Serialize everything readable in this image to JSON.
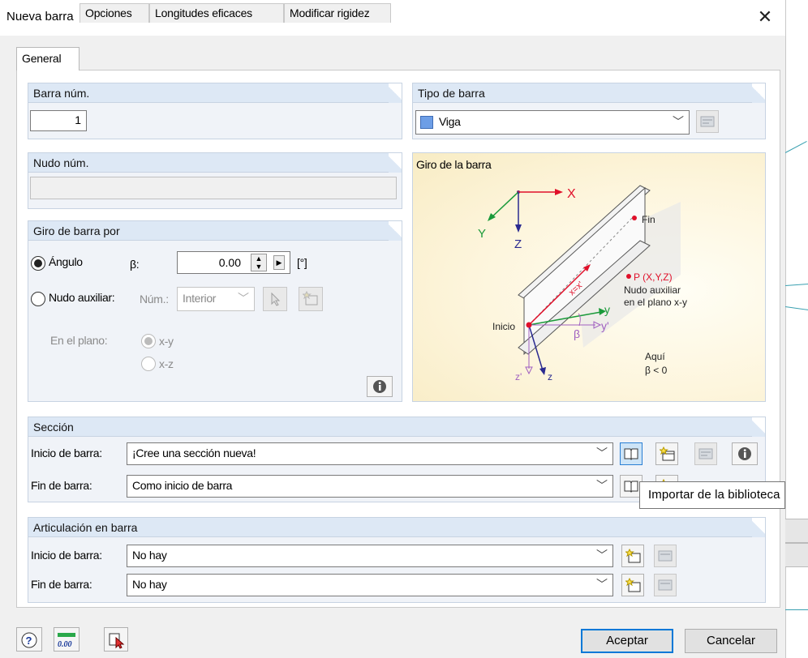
{
  "window": {
    "title": "Nueva barra",
    "close_symbol": "✕"
  },
  "tabs": [
    {
      "label": "General",
      "active": true
    },
    {
      "label": "Opciones",
      "active": false
    },
    {
      "label": "Longitudes eficaces",
      "active": false
    },
    {
      "label": "Modificar rigidez",
      "active": false
    }
  ],
  "barra_num": {
    "title": "Barra núm.",
    "value": "1"
  },
  "tipo_barra": {
    "title": "Tipo de barra",
    "value": "Viga",
    "color": "#6d9ee6"
  },
  "nudo_num": {
    "title": "Nudo núm.",
    "value": ""
  },
  "giro": {
    "title": "Giro de barra por",
    "angulo_label": "Ángulo",
    "beta_label": "β:",
    "beta_value": "0.00",
    "unit": "[°]",
    "nudo_aux_label": "Nudo auxiliar:",
    "num_label": "Núm.:",
    "num_combo": "Interior",
    "plano_label": "En el plano:",
    "plano_xy": "x-y",
    "plano_xz": "x-z"
  },
  "diagram": {
    "title": "Giro de la barra",
    "x_axis": "X",
    "y_axis": "Y",
    "z_axis": "Z",
    "fin": "Fin",
    "inicio": "Inicio",
    "p_label": "P (X,Y,Z)",
    "aux1": "Nudo auxiliar",
    "aux2": "en el plano x-y",
    "xx": "x=x'",
    "y": "y",
    "yp": "y'",
    "z": "z",
    "zp": "z'",
    "beta": "β",
    "aqui1": "Aquí",
    "aqui2": "β < 0"
  },
  "seccion": {
    "title": "Sección",
    "inicio_label": "Inicio de barra:",
    "inicio_value": "¡Cree una sección nueva!",
    "fin_label": "Fin de barra:",
    "fin_value": "Como inicio de barra"
  },
  "articulacion": {
    "title": "Articulación en barra",
    "inicio_label": "Inicio de barra:",
    "inicio_value": "No hay",
    "fin_label": "Fin de barra:",
    "fin_value": "No hay"
  },
  "tooltip": "Importar de la biblioteca",
  "footer": {
    "ok": "Aceptar",
    "cancel": "Cancelar",
    "zero_icon": "0.00"
  }
}
